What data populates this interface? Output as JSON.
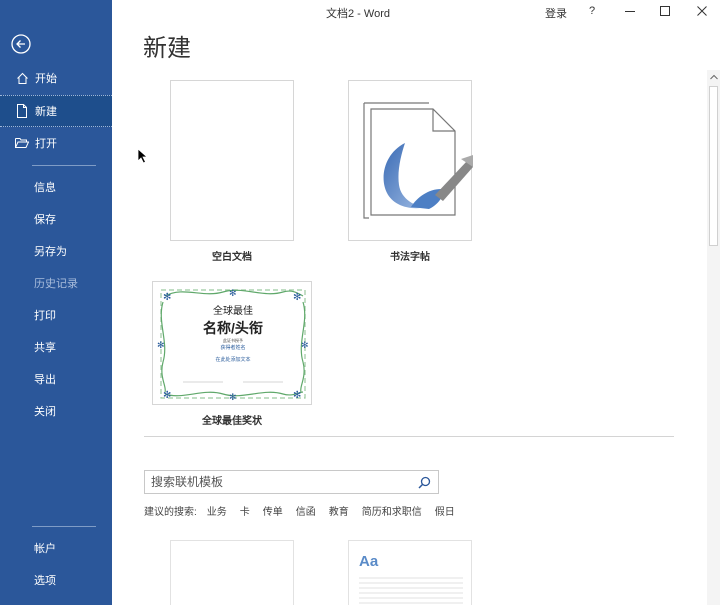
{
  "window": {
    "title": "文档2  -  Word",
    "signin_label": "登录",
    "help_label": "?"
  },
  "sidebar": {
    "items": [
      {
        "label": "开始",
        "icon": "home-icon"
      },
      {
        "label": "新建",
        "icon": "new-document-icon",
        "selected": true
      },
      {
        "label": "打开",
        "icon": "folder-open-icon"
      },
      {
        "label": "信息"
      },
      {
        "label": "保存"
      },
      {
        "label": "另存为"
      },
      {
        "label": "历史记录",
        "disabled": true
      },
      {
        "label": "打印"
      },
      {
        "label": "共享"
      },
      {
        "label": "导出"
      },
      {
        "label": "关闭"
      },
      {
        "label": "帐户"
      },
      {
        "label": "选项"
      }
    ]
  },
  "main": {
    "title": "新建",
    "templates": [
      {
        "label": "空白文档"
      },
      {
        "label": "书法字帖"
      },
      {
        "label": "全球最佳奖状"
      }
    ],
    "certificate": {
      "line1": "全球最佳",
      "line2": "名称/头衔",
      "line3": "此证书授予",
      "line4": "获得者姓名",
      "line5": "在此处添加文本"
    },
    "preview_text": "Aa",
    "search": {
      "placeholder": "搜索联机模板"
    },
    "suggested": {
      "label": "建议的搜索:",
      "links": [
        "业务",
        "卡",
        "传单",
        "信函",
        "教育",
        "简历和求职信",
        "假日"
      ]
    }
  },
  "colors": {
    "sidebar": "#2b579a",
    "sidebar_selected": "#1e4e8c",
    "accent_blue": "#2b579a",
    "calligraphy_blue": "#4d7fc4"
  }
}
